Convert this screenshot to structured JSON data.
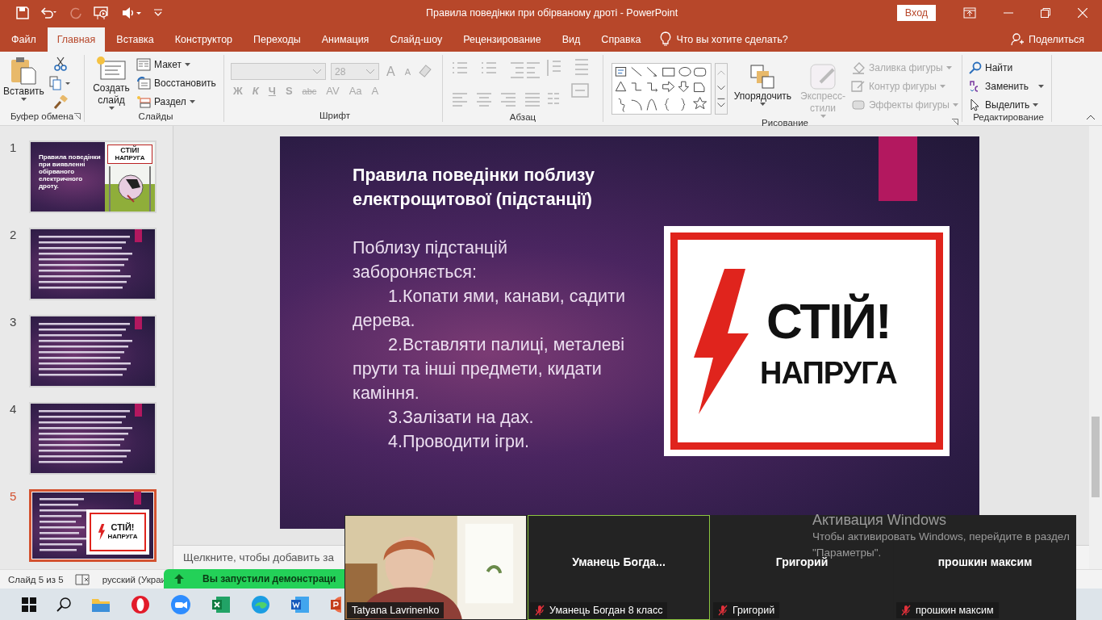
{
  "window": {
    "title": "Правила поведінки при обірваному дроті  -  PowerPoint",
    "signin": "Вход"
  },
  "tabs": [
    {
      "label": "Файл",
      "selected": false
    },
    {
      "label": "Главная",
      "selected": true
    },
    {
      "label": "Вставка",
      "selected": false
    },
    {
      "label": "Конструктор",
      "selected": false
    },
    {
      "label": "Переходы",
      "selected": false
    },
    {
      "label": "Анимация",
      "selected": false
    },
    {
      "label": "Слайд-шоу",
      "selected": false
    },
    {
      "label": "Рецензирование",
      "selected": false
    },
    {
      "label": "Вид",
      "selected": false
    },
    {
      "label": "Справка",
      "selected": false
    }
  ],
  "tell_me": "Что вы хотите сделать?",
  "share": "Поделиться",
  "ribbon": {
    "clipboard": {
      "paste": "Вставить",
      "label": "Буфер обмена"
    },
    "slides": {
      "new_slide": "Создать слайд",
      "layout": "Макет",
      "reset": "Восстановить",
      "section": "Раздел",
      "label": "Слайды"
    },
    "font": {
      "size": "28",
      "disabled": true,
      "size_buttons": [
        "A",
        "A"
      ],
      "styles": [
        "Ж",
        "К",
        "Ч",
        "S",
        "abc",
        "AV",
        "Aa",
        "A"
      ],
      "label": "Шрифт"
    },
    "paragraph": {
      "disabled": true,
      "label": "Абзац"
    },
    "drawing": {
      "arrange": "Упорядочить",
      "quick_styles": {
        "label": "Экспресс-стили",
        "disabled": true
      },
      "shape_actions": [
        {
          "kind": "fill",
          "label": "Заливка фигуры",
          "disabled": true
        },
        {
          "kind": "outline",
          "label": "Контур фигуры",
          "disabled": true
        },
        {
          "kind": "effects",
          "label": "Эффекты фигуры",
          "disabled": true
        }
      ],
      "label": "Рисование"
    },
    "editing": {
      "find": "Найти",
      "replace": "Заменить",
      "select": "Выделить",
      "label": "Редактирование"
    }
  },
  "thumbnails": [
    {
      "number": "1",
      "selected": false,
      "kind": "title_picture",
      "title": "Правила поведінки при виявленні обірваного електричного дроту.",
      "sign": [
        "СТІЙ!",
        "НАПРУГА"
      ]
    },
    {
      "number": "2",
      "selected": false,
      "kind": "text"
    },
    {
      "number": "3",
      "selected": false,
      "kind": "text"
    },
    {
      "number": "4",
      "selected": false,
      "kind": "text"
    },
    {
      "number": "5",
      "selected": true,
      "kind": "text_sign",
      "sign": [
        "СТІЙ!",
        "НАПРУГА"
      ]
    }
  ],
  "slide": {
    "title": "Правила поведінки поблизу електрощитової (підстанції)",
    "intro": "Поблизу підстанцій забороняється:",
    "items": [
      "1.Копати ями, канави, садити дерева.",
      "2.Вставляти палиці, металеві прути та інші предмети, кидати каміння.",
      "3.Залізати на дах.",
      "4.Проводити ігри."
    ],
    "sign": [
      "СТІЙ!",
      "НАПРУГА"
    ]
  },
  "notes_placeholder": "Щелкните, чтобы добавить за",
  "status_bar": {
    "slide": "Слайд 5 из 5",
    "language": "русский (Украи"
  },
  "share_banner": "Вы запустили демонстраци",
  "zoom": {
    "participants": [
      {
        "kind": "video",
        "name": "Tatyana Lavrinenko",
        "muted": false,
        "speaking": false
      },
      {
        "kind": "tile",
        "display": "Уманець  Богда...",
        "name": "Уманець Богдан 8 класс",
        "muted": true,
        "speaking": true
      },
      {
        "kind": "tile",
        "display": "Григорий",
        "name": "Григорий",
        "muted": true,
        "speaking": false
      },
      {
        "kind": "tile",
        "display": "прошкин максим",
        "name": "прошкин максим",
        "muted": true,
        "speaking": false
      }
    ]
  },
  "activation": {
    "title": "Активация Windows",
    "text": "Чтобы активировать Windows, перейдите в раздел \"Параметры\"."
  }
}
